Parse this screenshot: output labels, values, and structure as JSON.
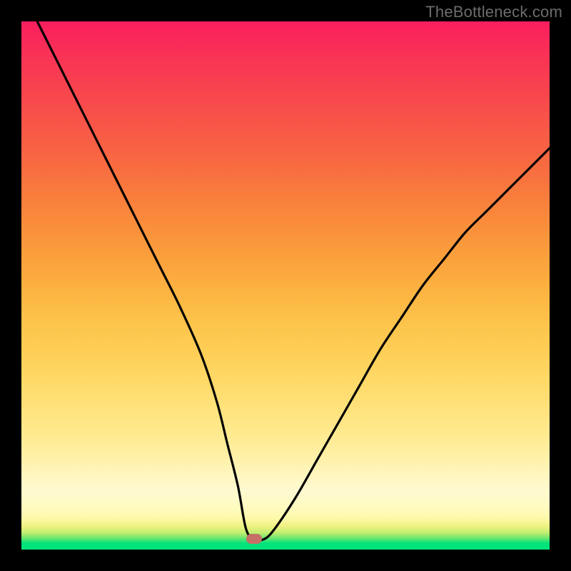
{
  "watermark": "TheBottleneck.com",
  "chart_data": {
    "type": "line",
    "title": "",
    "xlabel": "",
    "ylabel": "",
    "xlim": [
      0,
      100
    ],
    "ylim": [
      0,
      100
    ],
    "grid": false,
    "legend": false,
    "background": "rainbow-gradient-green-to-red-vertical",
    "series": [
      {
        "name": "bottleneck-curve",
        "x": [
          3,
          6,
          10,
          14,
          18,
          22,
          26,
          30,
          34,
          37,
          39,
          41,
          42.5,
          44,
          46,
          48,
          52,
          56,
          60,
          64,
          68,
          72,
          76,
          80,
          84,
          88,
          92,
          96,
          100
        ],
        "values": [
          100,
          94,
          86,
          78,
          70,
          62,
          54,
          46,
          37,
          28,
          20,
          12,
          4,
          2,
          2,
          4,
          10,
          17,
          24,
          31,
          38,
          44,
          50,
          55,
          60,
          64,
          68,
          72,
          76
        ]
      }
    ],
    "marker": {
      "x": 44,
      "y": 2,
      "color": "#c66f67"
    },
    "colors": {
      "curve": "#000000",
      "frame": "#000000",
      "gradient_top": "#fa1e5e",
      "gradient_mid": "#ffe27a",
      "gradient_bottom": "#02e37a"
    }
  }
}
